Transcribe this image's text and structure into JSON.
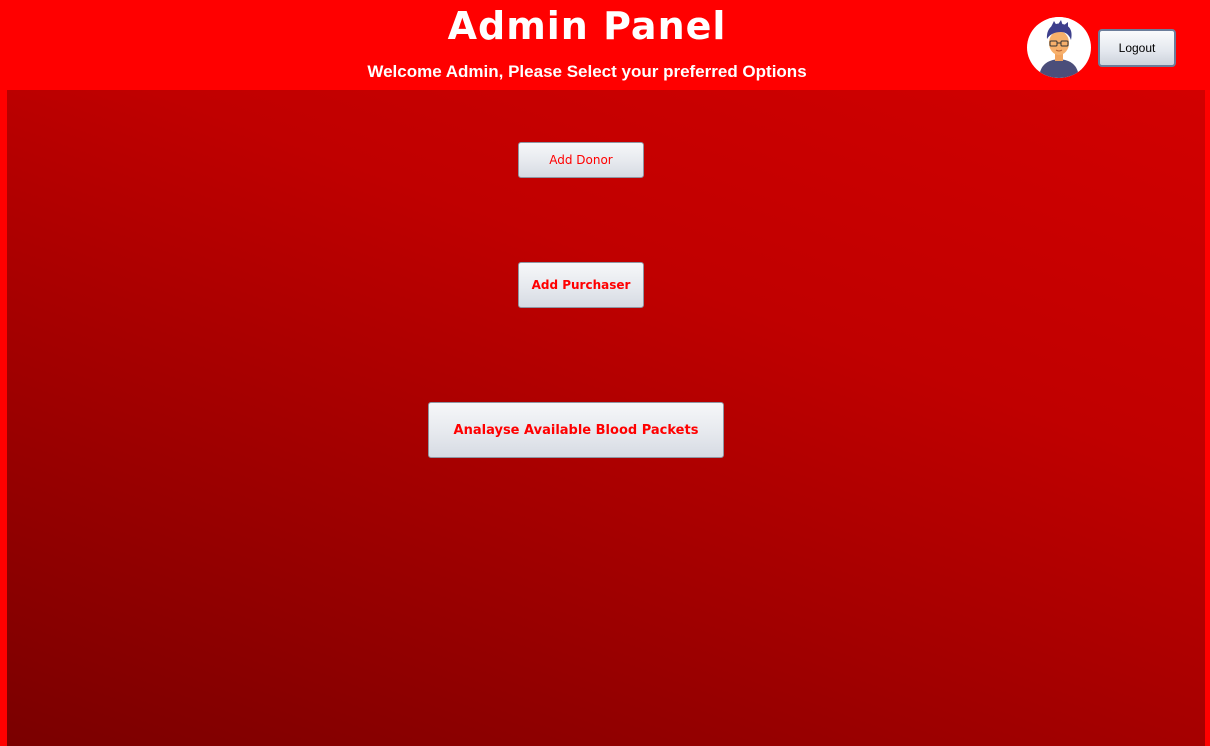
{
  "header": {
    "title": "Admin Panel",
    "subtitle": "Welcome Admin, Please Select your preferred Options",
    "logout_label": "Logout",
    "avatar_icon": "user-avatar-icon"
  },
  "actions": {
    "add_donor_label": "Add Donor",
    "add_purchaser_label": "Add Purchaser",
    "analyse_label": "Analayse Available Blood Packets"
  },
  "colors": {
    "header_bg": "#ff0000",
    "accent_text": "#ff0000",
    "panel_top": "#d20000",
    "panel_bottom": "#7a0000"
  }
}
